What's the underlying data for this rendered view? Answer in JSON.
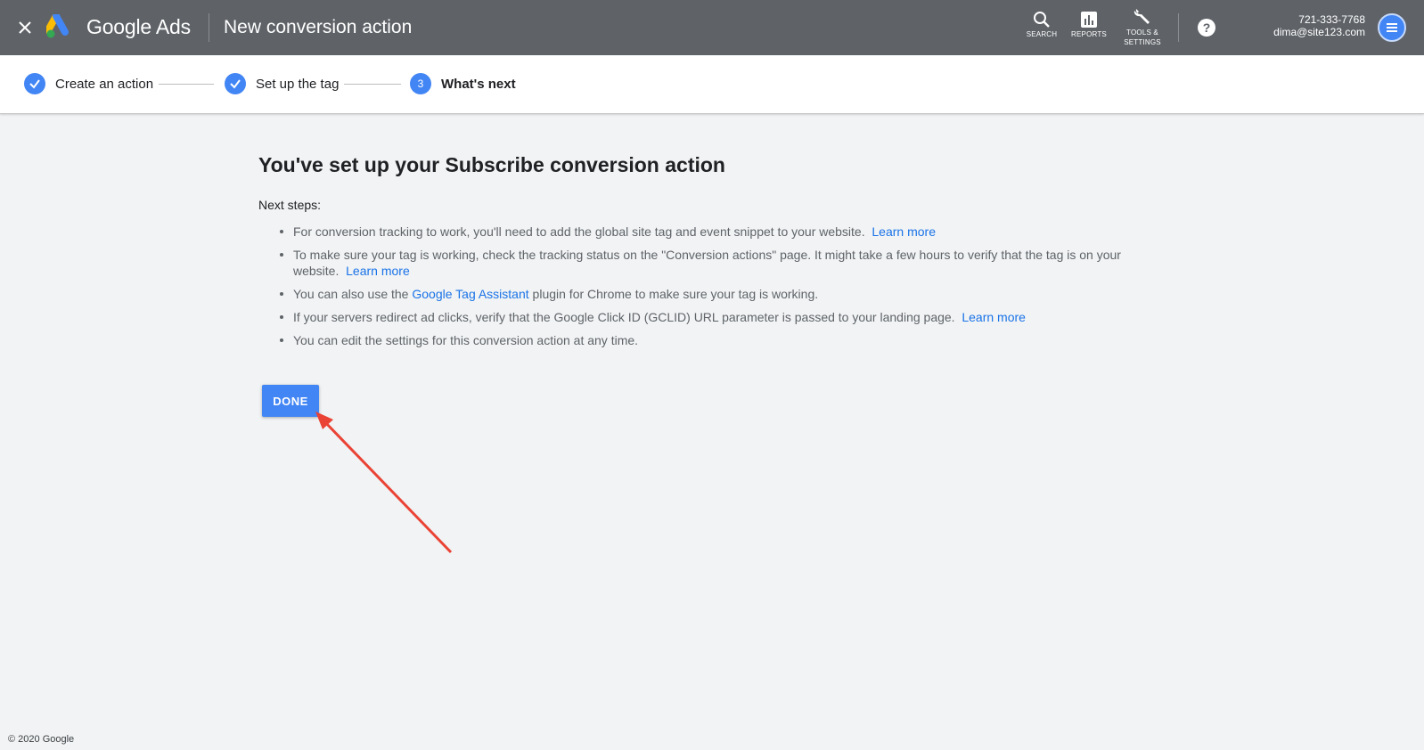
{
  "header": {
    "close_icon": "close-icon",
    "brand": "Google Ads",
    "title": "New conversion action",
    "tools": [
      {
        "icon": "search-icon",
        "label": "SEARCH"
      },
      {
        "icon": "reports-icon",
        "label": "REPORTS"
      },
      {
        "icon": "wrench-icon",
        "label_line1": "TOOLS &",
        "label_line2": "SETTINGS"
      }
    ],
    "help_icon": "help-icon",
    "account": {
      "phone": "721-333-7768",
      "email": "dima@site123.com"
    }
  },
  "stepper": {
    "steps": [
      {
        "label": "Create an action",
        "state": "complete"
      },
      {
        "label": "Set up the tag",
        "state": "complete"
      },
      {
        "label": "What's next",
        "state": "active",
        "number": "3"
      }
    ]
  },
  "main": {
    "heading_prefix": "You've set up your ",
    "heading_bold": "Subscribe",
    "heading_suffix": " conversion action",
    "next_steps_label": "Next steps:",
    "items": [
      {
        "text": "For conversion tracking to work, you'll need to add the global site tag and event snippet to your website.",
        "link": "Learn more"
      },
      {
        "text": "To make sure your tag is working, check the tracking status on the \"Conversion actions\" page. It might take a few hours to verify that the tag is on your website.",
        "link": "Learn more"
      },
      {
        "text_before": "You can also use the ",
        "link": "Google Tag Assistant",
        "text_after": " plugin for Chrome to make sure your tag is working."
      },
      {
        "text": "If your servers redirect ad clicks, verify that the Google Click ID (GCLID) URL parameter is passed to your landing page.",
        "link": "Learn more"
      },
      {
        "text": "You can edit the settings for this conversion action at any time."
      }
    ],
    "done_label": "DONE"
  },
  "footer": {
    "copyright": "© 2020 Google"
  },
  "colors": {
    "topbar": "#5f6368",
    "accent": "#4285f4",
    "link": "#1a73e8",
    "annotation_arrow": "#ea4335"
  }
}
